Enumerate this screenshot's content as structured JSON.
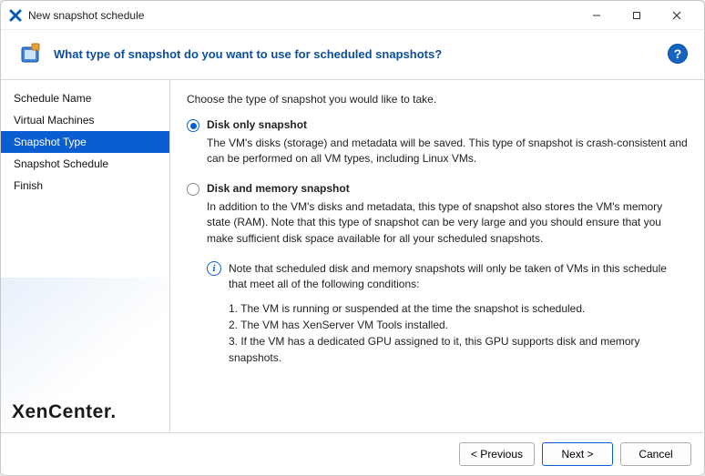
{
  "window": {
    "title": "New snapshot schedule"
  },
  "header": {
    "title": "What type of snapshot do you want to use for scheduled snapshots?"
  },
  "sidebar": {
    "items": [
      {
        "label": "Schedule Name",
        "selected": false
      },
      {
        "label": "Virtual Machines",
        "selected": false
      },
      {
        "label": "Snapshot Type",
        "selected": true
      },
      {
        "label": "Snapshot Schedule",
        "selected": false
      },
      {
        "label": "Finish",
        "selected": false
      }
    ]
  },
  "content": {
    "intro": "Choose the type of snapshot you would like to take.",
    "option1": {
      "label": "Disk only snapshot",
      "desc": "The VM's disks (storage) and metadata will be saved. This type of snapshot is crash-consistent and can be performed on all VM types, including Linux VMs.",
      "checked": true
    },
    "option2": {
      "label": "Disk and memory snapshot",
      "desc": "In addition to the VM's disks and metadata, this type of snapshot also stores the VM's memory state (RAM). Note that this type of snapshot can be very large and you should ensure that you make sufficient disk space available for all your scheduled snapshots.",
      "checked": false
    },
    "note": "Note that scheduled disk and memory snapshots will only be taken of VMs in this schedule that meet all of the following conditions:",
    "conditions": [
      "1. The VM is running or suspended at the time the snapshot is scheduled.",
      "2. The VM has XenServer VM Tools installed.",
      "3. If the VM has a dedicated GPU assigned to it, this GPU supports disk and memory snapshots."
    ]
  },
  "footer": {
    "previous": "< Previous",
    "next": "Next >",
    "cancel": "Cancel"
  },
  "brand": "XenCenter."
}
